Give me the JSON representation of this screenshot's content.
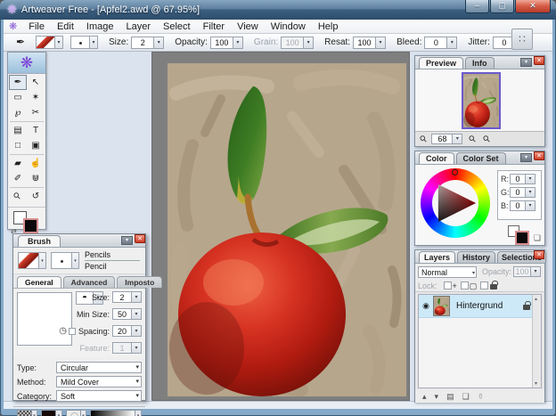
{
  "window": {
    "title": "Artweaver Free - [Apfel2.awd @ 67.95%]"
  },
  "menu": {
    "items": [
      "File",
      "Edit",
      "Image",
      "Layer",
      "Select",
      "Filter",
      "View",
      "Window",
      "Help"
    ]
  },
  "toolbar": {
    "fields": [
      {
        "label": "Size:",
        "value": "2"
      },
      {
        "label": "Opacity:",
        "value": "100"
      },
      {
        "label": "Grain:",
        "value": "100"
      },
      {
        "label": "Resat:",
        "value": "100"
      },
      {
        "label": "Bleed:",
        "value": "0"
      },
      {
        "label": "Jitter:",
        "value": "0"
      }
    ]
  },
  "brush_dialog": {
    "title": "Brush",
    "preset_category": "Pencils",
    "preset_name": "Pencil",
    "tabs": [
      "General",
      "Advanced",
      "Imposto"
    ],
    "size_label": "Size:",
    "size_value": "2",
    "min_size_label": "Min Size:",
    "min_size_value": "50",
    "spacing_label": "Spacing:",
    "spacing_value": "20",
    "feature_label": "Feature:",
    "feature_value": "1",
    "type_label": "Type:",
    "type_value": "Circular",
    "method_label": "Method:",
    "method_value": "Mild Cover",
    "category_label": "Category:",
    "category_value": "Soft"
  },
  "preview_panel": {
    "tabs": [
      "Preview",
      "Info"
    ],
    "zoom_value": "68"
  },
  "color_panel": {
    "tabs": [
      "Color",
      "Color Set"
    ],
    "r_label": "R:",
    "r_value": "0",
    "g_label": "G:",
    "g_value": "0",
    "b_label": "B:",
    "b_value": "0"
  },
  "layers_panel": {
    "tabs": [
      "Layers",
      "History",
      "Selections"
    ],
    "blend_mode": "Normal",
    "opacity_label": "Opacity:",
    "opacity_value": "100",
    "lock_label": "Lock:",
    "layer_name": "Hintergrund"
  },
  "icons": {
    "flower": "❋",
    "brush": "✒",
    "move": "↖",
    "rect_select": "▭",
    "magic_wand": "✶",
    "lasso": "℘",
    "crop": "✂",
    "stamp": "▤",
    "text": "T",
    "rect_shape": "□",
    "rounded_shape": "▣",
    "eraser": "▰",
    "smudge": "☝",
    "picker": "✐",
    "fill": "⋓",
    "zoom": "⚲",
    "rotate": "↺",
    "swap": "⇄",
    "dropdown": "▾",
    "close": "✕",
    "minimize": "–",
    "maximize": "▢",
    "grid": "∷",
    "semicircle": "◓",
    "clock": "◷",
    "eye": "◉",
    "plus": "+",
    "minus": "−",
    "frame": "▢",
    "scroll_up": "▴",
    "scroll_down": "▾",
    "folder": "▤",
    "new_layer": "❏",
    "trash": "⚱"
  },
  "colors": {
    "titlebar": "#3c5f80",
    "close_red": "#cf3b24",
    "border_blue": "#85aac9",
    "canvas_gray": "#7f7f7f",
    "selection_highlight": "#cde9f8",
    "thumb_border": "#6a5acd"
  }
}
